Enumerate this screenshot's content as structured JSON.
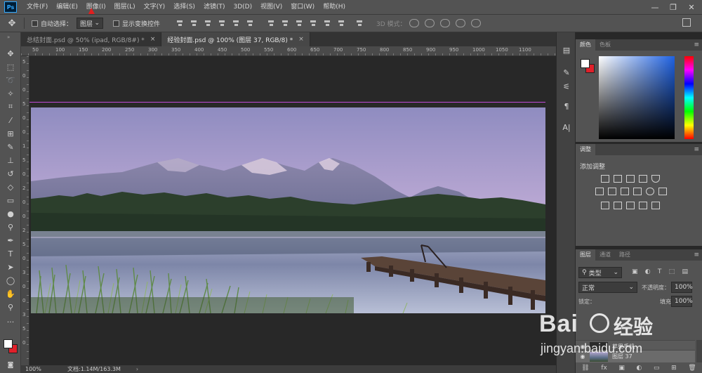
{
  "menubar": {
    "logo": "Ps",
    "items": [
      "文件(F)",
      "编辑(E)",
      "图像(I)",
      "图层(L)",
      "文字(Y)",
      "选择(S)",
      "滤镜(T)",
      "3D(D)",
      "视图(V)",
      "窗口(W)",
      "帮助(H)"
    ],
    "window_controls": [
      "—",
      "❐",
      "✕"
    ]
  },
  "options": {
    "auto_select_label": "自动选择：",
    "auto_select_value": "图层",
    "show_transform_label": "显示变换控件",
    "mode_3d_label": "3D 模式："
  },
  "tabs": [
    {
      "label": "总结封面.psd @ 50% (ipad, RGB/8#) *",
      "close": "×"
    },
    {
      "label": "经验封面.psd @ 100% (图层 37, RGB/8) *",
      "close": "×"
    }
  ],
  "status": {
    "zoom": "100%",
    "doc_info": "文档:1.14M/163.3M"
  },
  "ruler": {
    "top_marks": [
      "50",
      "100",
      "150",
      "200",
      "250",
      "300",
      "350",
      "400",
      "450",
      "500",
      "550",
      "600",
      "650",
      "700",
      "750",
      "800",
      "850",
      "900",
      "950",
      "1000",
      "1050",
      "1100"
    ],
    "left_marks": [
      "5",
      "0",
      "0",
      "5",
      "0",
      "0",
      "1",
      "5",
      "0",
      "2",
      "0",
      "0",
      "2",
      "5",
      "0",
      "3",
      "0",
      "0",
      "3",
      "5",
      "0"
    ]
  },
  "color_panel": {
    "tabs": [
      "颜色",
      "色板"
    ],
    "accent_red": "#e0202a",
    "hue_color": "#1f62e2"
  },
  "adjust_panel": {
    "tab": "调整",
    "add_label": "添加调整"
  },
  "layers_panel": {
    "tabs": [
      "图层",
      "通道",
      "路径"
    ],
    "filter": "类型",
    "blend_mode": "正常",
    "opacity_label": "不透明度：",
    "opacity_value": "100%",
    "lock_label": "锁定：",
    "fill_label": "填充：",
    "fill_value": "100%",
    "layers": [
      "苹果手机",
      "图层 37"
    ]
  },
  "watermark": {
    "brand": "Bai",
    "brand2": "经验",
    "url": "jingyan.baidu.com"
  }
}
